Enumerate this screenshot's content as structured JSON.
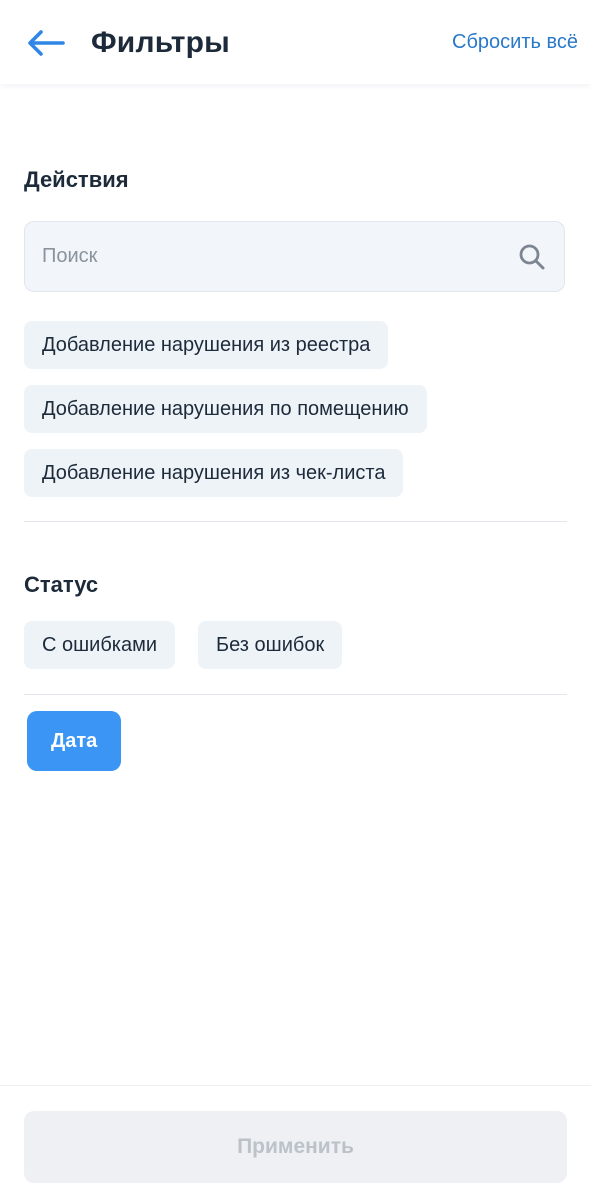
{
  "header": {
    "title": "Фильтры",
    "reset_label": "Сбросить всё",
    "back_icon": "arrow-left-icon",
    "accent_color": "#2979c8"
  },
  "actions": {
    "title": "Действия",
    "search": {
      "placeholder": "Поиск",
      "value": "",
      "icon": "search-icon"
    },
    "chips": [
      "Добавление нарушения из реестра",
      "Добавление нарушения по помещению",
      "Добавление нарушения из чек-листа"
    ]
  },
  "status": {
    "title": "Статус",
    "chips": [
      "С ошибками",
      "Без ошибок"
    ]
  },
  "date": {
    "label": "Дата",
    "active_color": "#3a95f4"
  },
  "footer": {
    "apply_label": "Применить",
    "apply_disabled": true
  }
}
